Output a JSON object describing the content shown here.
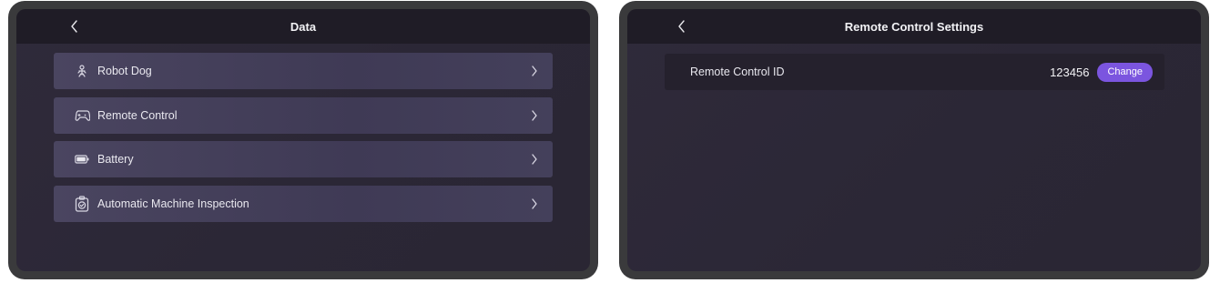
{
  "left_screen": {
    "header": {
      "back_icon": "chevron-left-icon",
      "title": "Data"
    },
    "items": [
      {
        "icon": "robot-dog-icon",
        "label": "Robot Dog"
      },
      {
        "icon": "gamepad-icon",
        "label": "Remote Control"
      },
      {
        "icon": "battery-icon",
        "label": "Battery"
      },
      {
        "icon": "inspection-icon",
        "label": "Automatic Machine Inspection"
      }
    ]
  },
  "right_screen": {
    "header": {
      "back_icon": "chevron-left-icon",
      "title": "Remote Control Settings"
    },
    "setting": {
      "label": "Remote Control ID",
      "value": "123456",
      "button_label": "Change"
    }
  },
  "colors": {
    "accent": "#7b55df",
    "header_bg": "#1f1c26",
    "list_item_bg": "#4a4560",
    "device_frame": "#3a3a3c"
  }
}
